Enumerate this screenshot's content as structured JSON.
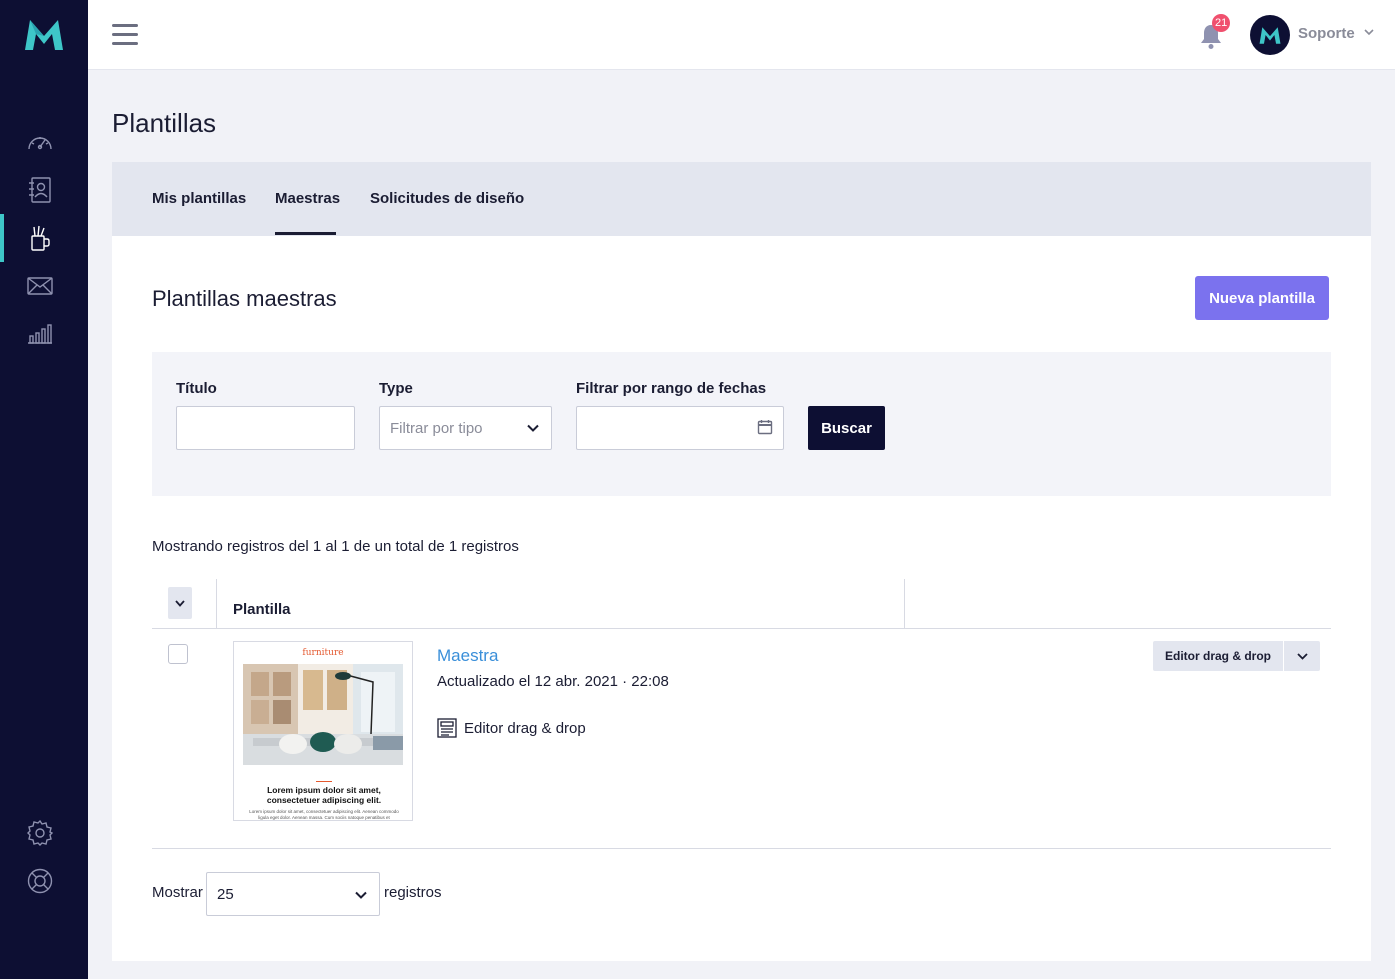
{
  "colors": {
    "sidebar_bg": "#0d0f33",
    "accent": "#3ec6c8",
    "primary_button": "#7b72ee",
    "link": "#3a8fd9",
    "badge": "#f0506e"
  },
  "sidebar": {
    "logo": "m-logo",
    "items": [
      {
        "icon": "speedometer-icon",
        "active": false
      },
      {
        "icon": "contacts-book-icon",
        "active": false
      },
      {
        "icon": "templates-brush-icon",
        "active": true
      },
      {
        "icon": "envelope-icon",
        "active": false
      },
      {
        "icon": "bar-chart-icon",
        "active": false
      }
    ],
    "bottom_items": [
      {
        "icon": "gear-icon"
      },
      {
        "icon": "lifebuoy-icon"
      }
    ]
  },
  "topbar": {
    "notifications_count": "21",
    "user_name": "Soporte"
  },
  "page": {
    "title": "Plantillas"
  },
  "tabs": [
    {
      "label": "Mis plantillas",
      "active": false
    },
    {
      "label": "Maestras",
      "active": true
    },
    {
      "label": "Solicitudes de diseño",
      "active": false
    }
  ],
  "card": {
    "title": "Plantillas maestras",
    "new_button": "Nueva plantilla"
  },
  "filters": {
    "title_label": "Título",
    "title_value": "",
    "type_label": "Type",
    "type_placeholder": "Filtrar por tipo",
    "date_label": "Filtrar por rango de fechas",
    "date_value": "",
    "search_button": "Buscar"
  },
  "records_info": "Mostrando registros del 1 al 1 de un total de 1 registros",
  "table": {
    "column_template": "Plantilla",
    "rows": [
      {
        "name": "Maestra",
        "updated": "Actualizado el 12 abr. 2021 · 22:08",
        "editor": "Editor drag & drop",
        "action_label": "Editor drag & drop",
        "thumbnail": {
          "brand": "furniture",
          "heading": "Lorem ipsum dolor sit amet, consectetuer adipiscing elit.",
          "body": "Lorem ipsum dolor sit amet, consectetuer adipiscing elit. Aenean commodo ligula eget dolor. Aenean massa. Cum sociis natoque penatibus et magnisLorem ipsum"
        }
      }
    ]
  },
  "pagination": {
    "show_label": "Mostrar",
    "page_size": "25",
    "suffix": "registros"
  }
}
